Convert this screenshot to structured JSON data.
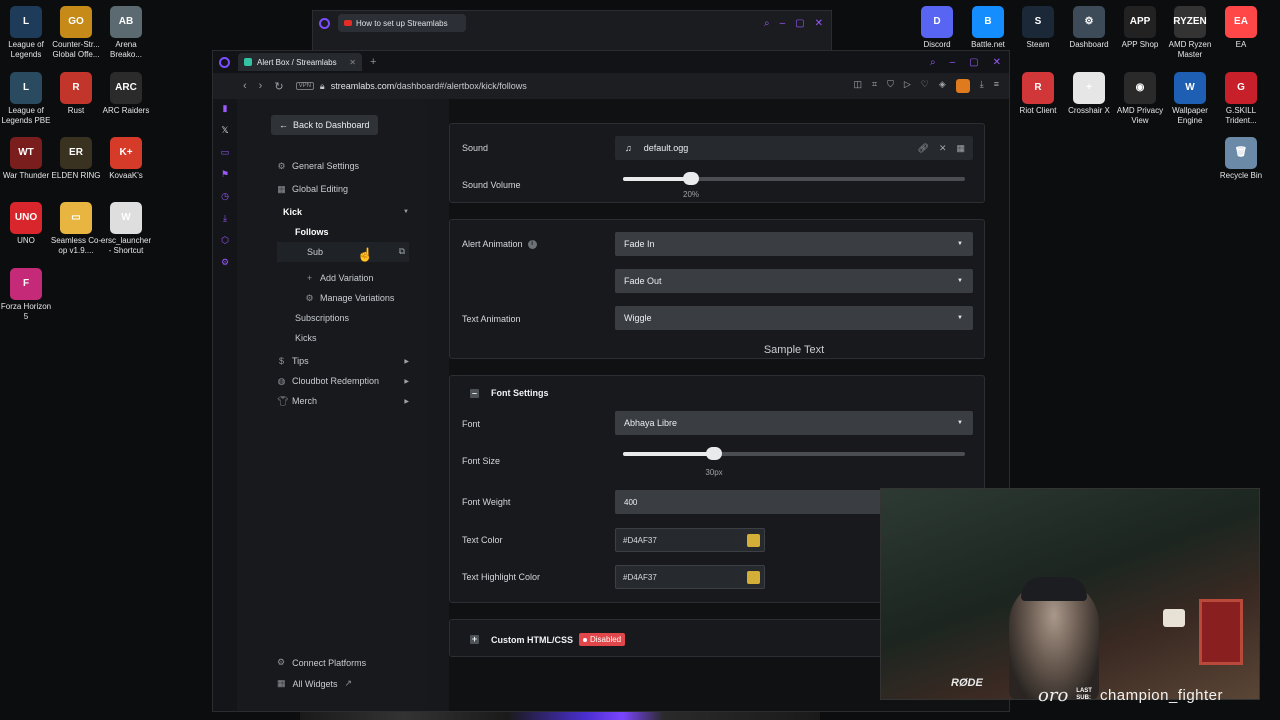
{
  "desktop": {
    "left_icons": [
      {
        "label": "League of Legends",
        "color": "#1f3b5a",
        "glyph": "L"
      },
      {
        "label": "Counter-Str... Global Offe...",
        "color": "#c58a18",
        "glyph": "GO"
      },
      {
        "label": "Arena Breako...",
        "color": "#5b6a70",
        "glyph": "AB"
      },
      {
        "label": "League of Legends PBE",
        "color": "#2a4a5f",
        "glyph": "L"
      },
      {
        "label": "Rust",
        "color": "#c2352b",
        "glyph": "R"
      },
      {
        "label": "ARC Raiders",
        "color": "#2b2b2b",
        "glyph": "ARC"
      },
      {
        "label": "War Thunder",
        "color": "#7a1d1d",
        "glyph": "WT"
      },
      {
        "label": "ELDEN RING",
        "color": "#3a3220",
        "glyph": "ER"
      },
      {
        "label": "KovaaK's",
        "color": "#d63b2a",
        "glyph": "K+"
      },
      {
        "label": "UNO",
        "color": "#d8262c",
        "glyph": "UNO"
      },
      {
        "label": "Seamless Co-op v1.9....",
        "color": "#e8b640",
        "glyph": "▭"
      },
      {
        "label": "ersc_launcher - Shortcut",
        "color": "#dedede",
        "glyph": "W"
      },
      {
        "label": "Forza Horizon 5",
        "color": "#c42a78",
        "glyph": "F"
      }
    ],
    "right_icons": [
      {
        "label": "Discord",
        "color": "#5865f2",
        "glyph": "D"
      },
      {
        "label": "Battle.net",
        "color": "#148eff",
        "glyph": "B"
      },
      {
        "label": "Steam",
        "color": "#1b2838",
        "glyph": "S"
      },
      {
        "label": "Dashboard",
        "color": "#3d4a57",
        "glyph": "⚙"
      },
      {
        "label": "APP Shop",
        "color": "#222",
        "glyph": "APP"
      },
      {
        "label": "AMD Ryzen Master",
        "color": "#333",
        "glyph": "RYZEN"
      },
      {
        "label": "EA",
        "color": "#ff4747",
        "glyph": "EA"
      },
      {
        "label": "Riot Client",
        "color": "#d13639",
        "glyph": "R"
      },
      {
        "label": "Crosshair X",
        "color": "#e6e6e6",
        "glyph": "+"
      },
      {
        "label": "AMD Privacy View",
        "color": "#2a2a2a",
        "glyph": "◉"
      },
      {
        "label": "Wallpaper Engine",
        "color": "#1e5fb3",
        "glyph": "W"
      },
      {
        "label": "G.SKILL Trident...",
        "color": "#c8202a",
        "glyph": "G"
      },
      {
        "label": "Recycle Bin",
        "color": "#6b8aa8",
        "glyph": "🗑"
      }
    ]
  },
  "back_window": {
    "tab_title": "How to set up Streamlabs"
  },
  "browser": {
    "tab_title": "Alert Box / Streamlabs",
    "vpn": "VPN",
    "url_host": "streamlabs.com",
    "url_path": "/dashboard#/alertbox/kick/follows"
  },
  "sidebar": {
    "back_label": "Back to Dashboard",
    "general_settings": "General Settings",
    "global_editing": "Global Editing",
    "kick": "Kick",
    "follows": "Follows",
    "sub": "Sub",
    "add_variation": "Add Variation",
    "manage_variations": "Manage Variations",
    "subscriptions": "Subscriptions",
    "kicks": "Kicks",
    "tips": "Tips",
    "cloudbot": "Cloudbot Redemption",
    "merch": "Merch",
    "connect_platforms": "Connect Platforms",
    "all_widgets": "All Widgets"
  },
  "sound_card": {
    "sound_label": "Sound",
    "sound_file": "default.ogg",
    "volume_label": "Sound Volume",
    "volume_value": "20%",
    "volume_fraction": 0.2
  },
  "animation_card": {
    "alert_animation_label": "Alert Animation",
    "alert_in": "Fade In",
    "alert_out": "Fade Out",
    "text_animation_label": "Text Animation",
    "text_animation": "Wiggle",
    "sample_text": "Sample Text"
  },
  "font_card": {
    "header": "Font Settings",
    "font_label": "Font",
    "font_value": "Abhaya Libre",
    "size_label": "Font Size",
    "size_value": "30px",
    "size_fraction": 0.265,
    "weight_label": "Font Weight",
    "weight_value": "400",
    "text_color_label": "Text Color",
    "text_color_value": "#D4AF37",
    "highlight_label": "Text Highlight Color",
    "highlight_value": "#D4AF37",
    "swatch_color": "#D4AF37"
  },
  "custom_card": {
    "header": "Custom HTML/CSS",
    "status": "Disabled"
  },
  "overlay": {
    "last_sub_tag_1": "LAST",
    "last_sub_tag_2": "SUB:",
    "last_sub_name": "champion_fighter",
    "brand": "oro",
    "mic_logo": "RØDE"
  }
}
